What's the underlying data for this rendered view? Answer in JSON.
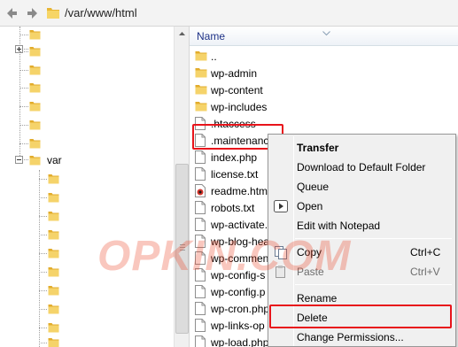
{
  "address": {
    "path": "/var/www/html"
  },
  "tree": {
    "var_label": "var"
  },
  "files": {
    "column_name": "Name",
    "rows": [
      {
        "name": "..",
        "icon": "folder-icon"
      },
      {
        "name": "wp-admin",
        "icon": "folder-icon"
      },
      {
        "name": "wp-content",
        "icon": "folder-icon"
      },
      {
        "name": "wp-includes",
        "icon": "folder-icon"
      },
      {
        "name": ".htaccess",
        "icon": "file-icon"
      },
      {
        "name": ".maintenanc",
        "icon": "file-icon"
      },
      {
        "name": "index.php",
        "icon": "file-icon"
      },
      {
        "name": "license.txt",
        "icon": "file-icon"
      },
      {
        "name": "readme.htm",
        "icon": "html-file-icon"
      },
      {
        "name": "robots.txt",
        "icon": "file-icon"
      },
      {
        "name": "wp-activate.",
        "icon": "file-icon"
      },
      {
        "name": "wp-blog-hea",
        "icon": "file-icon"
      },
      {
        "name": "wp-commen",
        "icon": "file-icon"
      },
      {
        "name": "wp-config-s",
        "icon": "file-icon"
      },
      {
        "name": "wp-config.p",
        "icon": "file-icon"
      },
      {
        "name": "wp-cron.php",
        "icon": "file-icon"
      },
      {
        "name": "wp-links-op",
        "icon": "file-icon"
      },
      {
        "name": "wp-load.php",
        "icon": "file-icon"
      }
    ]
  },
  "context_menu": {
    "transfer": "Transfer",
    "download": "Download to Default Folder",
    "queue": "Queue",
    "open": "Open",
    "edit": "Edit with Notepad",
    "copy": "Copy",
    "copy_shortcut": "Ctrl+C",
    "paste": "Paste",
    "paste_shortcut": "Ctrl+V",
    "rename": "Rename",
    "delete": "Delete",
    "permissions": "Change Permissions..."
  },
  "watermark": "OPKIN.COM",
  "colors": {
    "highlight": "#e8141b",
    "folder": "#f2c94c",
    "header_text": "#1e3287"
  }
}
